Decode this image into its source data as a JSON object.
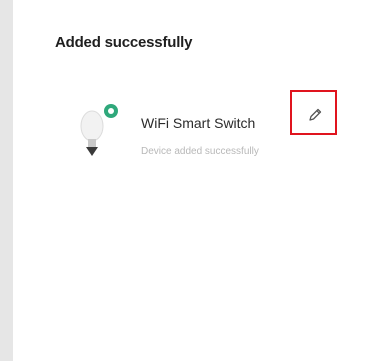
{
  "dialog": {
    "title": "Added successfully"
  },
  "device": {
    "name": "WiFi Smart Switch",
    "status_text": "Device added successfully",
    "icon": "bulb-icon",
    "status_icon": "online-status-icon",
    "edit_icon": "pencil-icon",
    "status_color": "#2fa87b",
    "highlight_color": "#e0141e"
  }
}
